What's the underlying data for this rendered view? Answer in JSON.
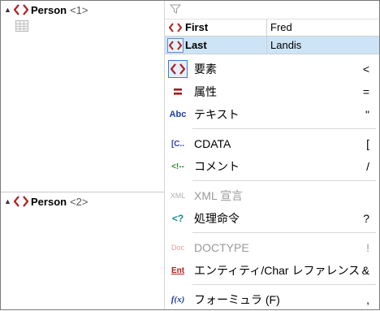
{
  "tree": [
    {
      "name": "Person",
      "index": "<1>"
    },
    {
      "name": "Person",
      "index": "<2>"
    }
  ],
  "attributes": [
    {
      "name": "First",
      "value": "Fred"
    },
    {
      "name": "Last",
      "value": "Landis"
    }
  ],
  "menu": [
    {
      "label": "要素",
      "key": "<",
      "icon": "element-icon",
      "disabled": false
    },
    {
      "label": "属性",
      "key": "=",
      "icon": "attribute-icon",
      "disabled": false
    },
    {
      "label": "テキスト",
      "key": "\"",
      "icon": "text-icon",
      "disabled": false
    },
    {
      "label": "CDATA",
      "key": "[",
      "icon": "cdata-icon",
      "disabled": false
    },
    {
      "label": "コメント",
      "key": "/",
      "icon": "comment-icon",
      "disabled": false
    },
    {
      "label": "XML 宣言",
      "key": "",
      "icon": "xml-declaration-icon",
      "disabled": true
    },
    {
      "label": "処理命令",
      "key": "?",
      "icon": "processing-instruction-icon",
      "disabled": false
    },
    {
      "label": "DOCTYPE",
      "key": "!",
      "icon": "doctype-icon",
      "disabled": true
    },
    {
      "label": "エンティティ/Char レファレンス",
      "key": "&",
      "icon": "entity-icon",
      "disabled": false
    },
    {
      "label": "フォーミュラ (F)",
      "key": ",",
      "icon": "formula-icon",
      "disabled": false
    }
  ],
  "icon_text": {
    "text": "Abc",
    "cdata": "[C..",
    "comment": "<!--",
    "xml": "XML",
    "pi": "<?",
    "doctype": "Doc",
    "entity": "Ent",
    "formula": "f(x)"
  },
  "colors": {
    "element_red": "#b02020",
    "selection": "#cde4f7",
    "accent_blue": "#3b79d0"
  }
}
